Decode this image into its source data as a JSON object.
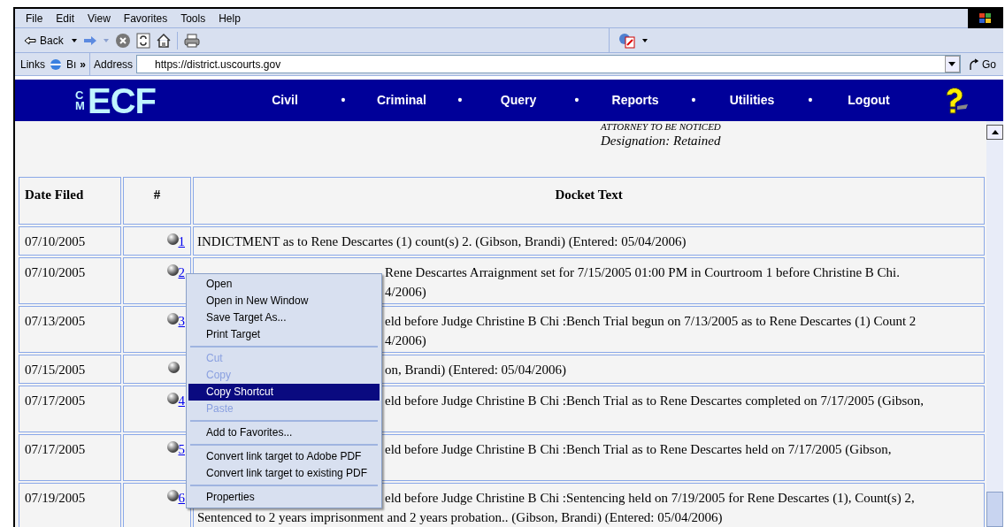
{
  "menu_bar": [
    "File",
    "Edit",
    "View",
    "Favorites",
    "Tools",
    "Help"
  ],
  "toolbar": {
    "back": "Back"
  },
  "links_bar": {
    "label": "Links",
    "item": "Bı",
    "chevron": "»"
  },
  "address_bar": {
    "label": "Address",
    "value": "https://district.uscourts.gov",
    "go": "Go"
  },
  "banner": {
    "logo_small": "CM",
    "logo": "ECF",
    "nav": [
      "Civil",
      "Criminal",
      "Query",
      "Reports",
      "Utilities",
      "Logout"
    ],
    "separator": "•"
  },
  "attorney": {
    "role": "ATTORNEY TO BE NOTICED",
    "designation": "Designation: Retained"
  },
  "table": {
    "columns": [
      "Date Filed",
      "#",
      "Docket Text"
    ],
    "rows": [
      {
        "date": "07/10/2005",
        "number": "1",
        "lines": [
          {
            "kind": "full",
            "text": "INDICTMENT as to Rene Descartes (1) count(s) 2. (Gibson, Brandi) (Entered: 05/04/2006)"
          }
        ]
      },
      {
        "date": "07/10/2005",
        "number": "2",
        "lines": [
          {
            "kind": "partial",
            "text": "Rene Descartes Arraignment set for 7/15/2005 01:00 PM in Courtroom 1 before Christine B Chi."
          },
          {
            "kind": "partial",
            "text": "4/2006)"
          }
        ]
      },
      {
        "date": "07/13/2005",
        "number": "3",
        "lines": [
          {
            "kind": "partial",
            "text": "eld before Judge Christine B Chi :Bench Trial begun on 7/13/2005 as to Rene Descartes (1) Count 2"
          },
          {
            "kind": "partial",
            "text": "4/2006)"
          }
        ]
      },
      {
        "date": "07/15/2005",
        "lines": [
          {
            "kind": "partial",
            "text": "on, Brandi) (Entered: 05/04/2006)"
          }
        ]
      },
      {
        "date": "07/17/2005",
        "number": "4",
        "lines": [
          {
            "kind": "partial",
            "text": "eld before Judge Christine B Chi :Bench Trial as to Rene Descartes completed on 7/17/2005 (Gibson,"
          }
        ]
      },
      {
        "date": "07/17/2005",
        "number": "5",
        "lines": [
          {
            "kind": "partial",
            "text": "eld before Judge Christine B Chi :Bench Trial as to Rene Descartes held on 7/17/2005 (Gibson,"
          }
        ]
      },
      {
        "date": "07/19/2005",
        "number": "6",
        "lines": [
          {
            "kind": "partial",
            "text": "eld before Judge Christine B Chi :Sentencing held on 7/19/2005 for Rene Descartes (1), Count(s) 2,"
          },
          {
            "kind": "full",
            "text": "Sentenced to 2 years imprisonment and 2 years probation.. (Gibson, Brandi) (Entered: 05/04/2006)"
          }
        ]
      }
    ]
  },
  "context_menu": [
    {
      "kind": "item",
      "label": "Open",
      "disabled": false,
      "selected": false
    },
    {
      "kind": "item",
      "label": "Open in New Window",
      "disabled": false,
      "selected": false
    },
    {
      "kind": "item",
      "label": "Save Target As...",
      "disabled": false,
      "selected": false
    },
    {
      "kind": "item",
      "label": "Print Target",
      "disabled": false,
      "selected": false
    },
    {
      "kind": "separator"
    },
    {
      "kind": "item",
      "label": "Cut",
      "disabled": true,
      "selected": false
    },
    {
      "kind": "item",
      "label": "Copy",
      "disabled": true,
      "selected": false
    },
    {
      "kind": "item",
      "label": "Copy Shortcut",
      "disabled": false,
      "selected": true
    },
    {
      "kind": "item",
      "label": "Paste",
      "disabled": true,
      "selected": false
    },
    {
      "kind": "separator"
    },
    {
      "kind": "item",
      "label": "Add to Favorites...",
      "disabled": false,
      "selected": false
    },
    {
      "kind": "separator"
    },
    {
      "kind": "item",
      "label": "Convert link target to Adobe PDF",
      "disabled": false,
      "selected": false
    },
    {
      "kind": "item",
      "label": "Convert link target to existing PDF",
      "disabled": false,
      "selected": false
    },
    {
      "kind": "separator"
    },
    {
      "kind": "item",
      "label": "Properties",
      "disabled": false,
      "selected": false
    }
  ]
}
